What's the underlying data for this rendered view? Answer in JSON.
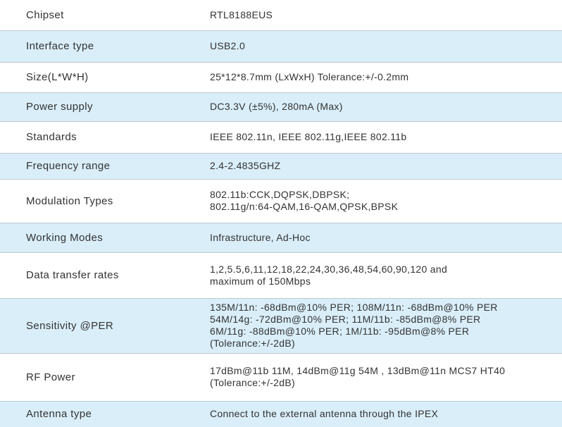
{
  "specs": [
    {
      "label": "Chipset",
      "lines": [
        "RTL8188EUS"
      ]
    },
    {
      "label": "Interface type",
      "lines": [
        "USB2.0"
      ]
    },
    {
      "label": "Size(L*W*H)",
      "lines": [
        "25*12*8.7mm (LxWxH) Tolerance:+/-0.2mm"
      ]
    },
    {
      "label": "Power supply",
      "lines": [
        "DC3.3V (±5%), 280mA (Max)"
      ]
    },
    {
      "label": "Standards",
      "lines": [
        "IEEE 802.11n, IEEE 802.11g,IEEE 802.11b"
      ]
    },
    {
      "label": "Frequency range",
      "lines": [
        "2.4-2.4835GHZ"
      ]
    },
    {
      "label": "Modulation Types",
      "lines": [
        "802.11b:CCK,DQPSK,DBPSK;",
        "802.11g/n:64-QAM,16-QAM,QPSK,BPSK"
      ]
    },
    {
      "label": "Working Modes",
      "lines": [
        "Infrastructure,  Ad-Hoc"
      ]
    },
    {
      "label": "Data transfer rates",
      "lines": [
        "1,2,5.5,6,11,12,18,22,24,30,36,48,54,60,90,120 and",
        "maximum of 150Mbps"
      ]
    },
    {
      "label": "Sensitivity @PER",
      "lines": [
        "135M/11n: -68dBm@10% PER; 108M/11n: -68dBm@10% PER",
        "54M/14g: -72dBm@10% PER;  11M/11b: -85dBm@8% PER",
        "6M/11g: -88dBm@10% PER; 1M/11b: -95dBm@8% PER",
        "(Tolerance:+/-2dB)"
      ]
    },
    {
      "label": "RF Power",
      "lines": [
        "17dBm@11b 11M, 14dBm@11g 54M , 13dBm@11n MCS7 HT40",
        "(Tolerance:+/-2dB)"
      ]
    },
    {
      "label": "Antenna type",
      "lines": [
        "Connect to the external antenna through the IPEX"
      ]
    }
  ]
}
